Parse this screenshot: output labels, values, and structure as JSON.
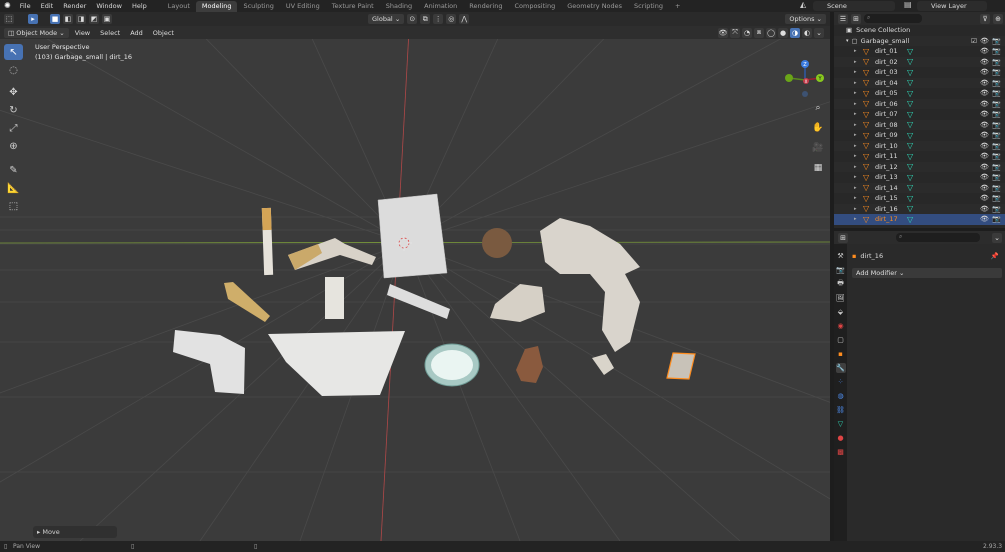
{
  "topbar": {
    "menus": [
      "File",
      "Edit",
      "Render",
      "Window",
      "Help"
    ],
    "workspaces": [
      "Layout",
      "Modeling",
      "Sculpting",
      "UV Editing",
      "Texture Paint",
      "Shading",
      "Animation",
      "Rendering",
      "Compositing",
      "Geometry Nodes",
      "Scripting"
    ],
    "active_workspace": "Modeling",
    "add_tab": "+",
    "scene": "Scene",
    "view_layer": "View Layer"
  },
  "viewport": {
    "mode": "Object Mode",
    "menus": [
      "View",
      "Select",
      "Add",
      "Object"
    ],
    "transform_orientation": "Global",
    "options_label": "Options",
    "info_line1": "User Perspective",
    "info_line2": "(103) Garbage_small | dirt_16",
    "last_operator": "Move",
    "gizmo": {
      "x": "X",
      "y": "Y",
      "z": "Z"
    }
  },
  "statusbar": {
    "left": "Pan View",
    "version": "2.93.3"
  },
  "outliner": {
    "root": "Scene Collection",
    "collection": "Garbage_small",
    "objects": [
      "dirt_01",
      "dirt_02",
      "dirt_03",
      "dirt_04",
      "dirt_05",
      "dirt_06",
      "dirt_07",
      "dirt_08",
      "dirt_09",
      "dirt_10",
      "dirt_11",
      "dirt_12",
      "dirt_13",
      "dirt_14",
      "dirt_15",
      "dirt_16",
      "dirt_17"
    ],
    "selected_index": 16
  },
  "properties": {
    "object_name": "dirt_16",
    "add_modifier_label": "Add Modifier"
  },
  "colors": {
    "accent": "#4772b3",
    "selected_object": "#ff8d1f",
    "mesh": "#2fdcbb"
  }
}
